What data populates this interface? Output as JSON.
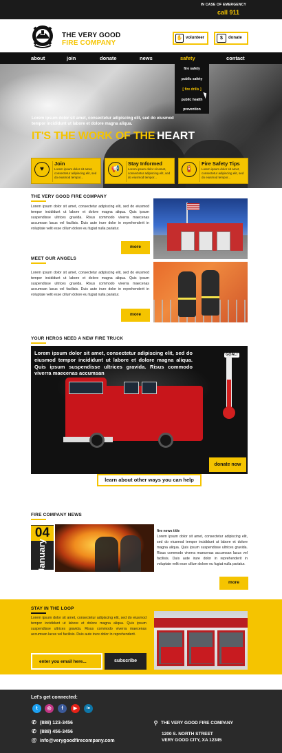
{
  "emergency": {
    "label": "IN CASE OF EMERGENCY",
    "call": "call 911"
  },
  "brand": {
    "line1": "THE VERY GOOD",
    "line2": "FIRE COMPANY",
    "logo_icon": "firefighter-helmet-logo"
  },
  "header_buttons": {
    "volunteer": "volunteer",
    "donate": "donate"
  },
  "nav": {
    "items": [
      "about",
      "join",
      "donate",
      "news",
      "safety",
      "contact"
    ],
    "active": "safety",
    "dropdown": [
      "fire safety",
      "public safety",
      "fire drills",
      "public health",
      "prevention"
    ],
    "dropdown_highlight": "fire drills"
  },
  "hero": {
    "text": "Lorem ipsum dolor sit amet, consectetur adipiscing elit, sed do eiusmod tempor incididunt ut labore et dolore magna aliqua.",
    "title_yellow": "IT'S THE WORK OF THE",
    "title_white": "HEART",
    "cards": [
      {
        "title": "Join",
        "body": "Lorem ipsum dolor sit amet, consectetur adipiscing elit, sed do eiusmod tempor...",
        "icon": "heart-hand-icon"
      },
      {
        "title": "Stay Informed",
        "body": "Lorem ipsum dolor sit amet, consectetur adipiscing elit, sed do eiusmod tempor...",
        "icon": "megaphone-icon"
      },
      {
        "title": "Fire Safety Tips",
        "body": "Lorem ipsum dolor sit amet, consectetur adipiscing elit, sed do eiusmod tempor...",
        "icon": "fire-extinguisher-icon"
      }
    ]
  },
  "about_section": {
    "title": "THE VERY GOOD FIRE COMPANY",
    "body": "Lorem ipsum dolor sit amet, consectetur adipiscing elit, sed do eiusmod tempor incididunt ut labore et dolore magna aliqua. Quis ipsum suspendisse ultrices gravida. Risus commodo viverra maecenas accumsan lacus vel facilisis. Duis aute irure dolor in reprehenderit in voluptate velit esse cillum dolore eu fugiat nulla pariatur.",
    "more": "more"
  },
  "angels_section": {
    "title": "MEET OUR ANGELS",
    "body": "Lorem ipsum dolor sit amet, consectetur adipiscing elit, sed do eiusmod tempor incididunt ut labore et dolore magna aliqua. Quis ipsum suspendisse ultrices gravida. Risus commodo viverra maecenas accumsan lacus vel facilisis. Duis aute irure dolor in reprehenderit in voluptate velit esse cillum dolore eu fugiat nulla pariatur.",
    "more": "more"
  },
  "truck_section": {
    "title": "YOUR HEROS NEED A NEW FIRE TRUCK",
    "body": "Lorem ipsum dolor sit amet, consectetur adipiscing elit, sed do eiusmod tempor incididunt ut labore et dolore magna aliqua. Quis ipsum suspendisse ultrices gravida. Risus commodo viverra maecenas accumsan",
    "goal_label": "GOAL!",
    "goal_progress": 0.55,
    "donate": "donate now",
    "learn": "learn about other ways you can help"
  },
  "news_section": {
    "title": "FIRE COMPANY NEWS",
    "day": "04",
    "month": "January",
    "headline": "fire news title",
    "body": "Lorem ipsum dolor sit amet, consectetur adipiscing elit, sed do eiusmod tempor incididunt ut labore et dolore magna aliqua. Quis ipsum suspendisse ultrices gravida. Risus commodo viverra maecenas accumsan lacus vel facilisis. Duis aute irure dolor in reprehenderit in voluptate velit esse cillum dolore eu fugiat nulla pariatur.",
    "more": "more"
  },
  "newsletter": {
    "title": "STAY IN THE LOOP",
    "body": "Lorem ipsum dolor sit amet, consectetur adipiscing elit, sed do eiusmod tempor incididunt ut labore et dolore magna aliqua. Quis ipsum suspendisse ultrices gravida. Risus commodo viverra maecenas accumsan lacus vel facilisis. Duis aute irure dolor in reprehenderit.",
    "placeholder": "enter you email here...",
    "subscribe": "subscribe"
  },
  "footer": {
    "connect": "Let's get connected:",
    "social": [
      {
        "icon": "twitter-icon",
        "glyph": "t",
        "color": "#1da1f2"
      },
      {
        "icon": "instagram-icon",
        "glyph": "◎",
        "color": "#c13584"
      },
      {
        "icon": "facebook-icon",
        "glyph": "f",
        "color": "#3b5998"
      },
      {
        "icon": "youtube-icon",
        "glyph": "▶",
        "color": "#e62117"
      },
      {
        "icon": "linkedin-icon",
        "glyph": "in",
        "color": "#0e76a8"
      }
    ],
    "phone1": "(888) 123-3456",
    "phone2": "(888) 456-3456",
    "email": "info@verygoodfirecompany.com",
    "company": "THE VERY GOOD FIRE COMPANY",
    "address1": "1200 S. NORTH STREET",
    "address2": "VERY GOOD CITY, XA 12345"
  },
  "colors": {
    "accent": "#f5c400",
    "dark": "#1b1b1b",
    "truck_red": "#c8151b"
  }
}
